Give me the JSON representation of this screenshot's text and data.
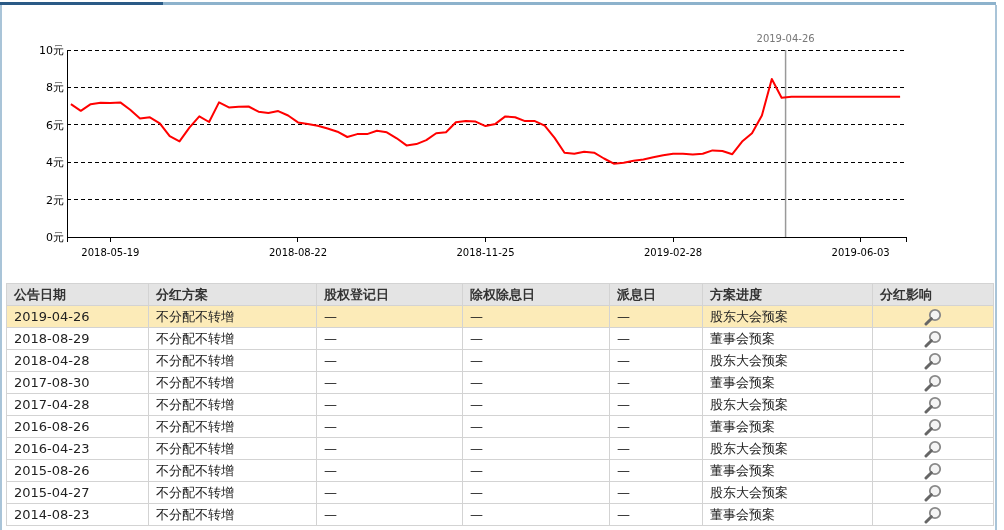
{
  "chart": {
    "chart_data": {
      "type": "line",
      "grid": true,
      "ylim": [
        0,
        10
      ],
      "yticks": [
        {
          "value": 0,
          "label": "0元"
        },
        {
          "value": 2,
          "label": "2元"
        },
        {
          "value": 4,
          "label": "4元"
        },
        {
          "value": 6,
          "label": "6元"
        },
        {
          "value": 8,
          "label": "8元"
        },
        {
          "value": 10,
          "label": "10元"
        }
      ],
      "categories": [
        null,
        null,
        null,
        null,
        "2018-05-19",
        null,
        null,
        null,
        null,
        null,
        null,
        null,
        null,
        null,
        null,
        null,
        null,
        null,
        null,
        null,
        null,
        null,
        null,
        "2018-08-22",
        null,
        null,
        null,
        null,
        null,
        null,
        null,
        null,
        null,
        null,
        null,
        null,
        null,
        null,
        null,
        null,
        null,
        null,
        "2018-11-25",
        null,
        null,
        null,
        null,
        null,
        null,
        null,
        null,
        null,
        null,
        null,
        null,
        null,
        null,
        null,
        null,
        null,
        null,
        "2019-02-28",
        null,
        null,
        null,
        null,
        null,
        null,
        null,
        null,
        null,
        null,
        null,
        null,
        null,
        null,
        null,
        null,
        null,
        null,
        "2019-06-03",
        null,
        null,
        null,
        null
      ],
      "series": [
        {
          "color": "#ff0000",
          "values": [
            7.1,
            6.75,
            7.1,
            7.18,
            7.16,
            7.2,
            6.8,
            6.34,
            6.4,
            6.08,
            5.39,
            5.11,
            5.85,
            6.45,
            6.15,
            7.2,
            6.93,
            6.97,
            6.98,
            6.7,
            6.63,
            6.73,
            6.5,
            6.13,
            6.05,
            5.95,
            5.8,
            5.63,
            5.35,
            5.5,
            5.5,
            5.68,
            5.6,
            5.28,
            4.9,
            4.97,
            5.18,
            5.55,
            5.6,
            6.14,
            6.2,
            6.17,
            5.93,
            6.05,
            6.45,
            6.4,
            6.2,
            6.2,
            5.95,
            5.3,
            4.5,
            4.45,
            4.56,
            4.51,
            4.2,
            3.92,
            3.97,
            4.08,
            4.15,
            4.27,
            4.37,
            4.45,
            4.45,
            4.41,
            4.45,
            4.63,
            4.6,
            4.43,
            5.1,
            5.55,
            6.5,
            8.45,
            7.45,
            7.5,
            7.5,
            7.5,
            7.5,
            7.5,
            7.5,
            7.5,
            7.5,
            7.5,
            7.5,
            7.5,
            7.5
          ]
        }
      ],
      "annotations": [
        "2019-04-26"
      ]
    }
  },
  "table": {
    "columns": [
      "公告日期",
      "分红方案",
      "股权登记日",
      "除权除息日",
      "派息日",
      "方案进度",
      "分红影响"
    ],
    "rows": [
      {
        "selected": true,
        "cells": [
          "2019-04-26",
          "不分配不转增",
          "—",
          "—",
          "—",
          "股东大会预案"
        ]
      },
      {
        "selected": false,
        "cells": [
          "2018-08-29",
          "不分配不转增",
          "—",
          "—",
          "—",
          "董事会预案"
        ]
      },
      {
        "selected": false,
        "cells": [
          "2018-04-28",
          "不分配不转增",
          "—",
          "—",
          "—",
          "股东大会预案"
        ]
      },
      {
        "selected": false,
        "cells": [
          "2017-08-30",
          "不分配不转增",
          "—",
          "—",
          "—",
          "董事会预案"
        ]
      },
      {
        "selected": false,
        "cells": [
          "2017-04-28",
          "不分配不转增",
          "—",
          "—",
          "—",
          "股东大会预案"
        ]
      },
      {
        "selected": false,
        "cells": [
          "2016-08-26",
          "不分配不转增",
          "—",
          "—",
          "—",
          "董事会预案"
        ]
      },
      {
        "selected": false,
        "cells": [
          "2016-04-23",
          "不分配不转增",
          "—",
          "—",
          "—",
          "股东大会预案"
        ]
      },
      {
        "selected": false,
        "cells": [
          "2015-08-26",
          "不分配不转增",
          "—",
          "—",
          "—",
          "董事会预案"
        ]
      },
      {
        "selected": false,
        "cells": [
          "2015-04-27",
          "不分配不转增",
          "—",
          "—",
          "—",
          "股东大会预案"
        ]
      },
      {
        "selected": false,
        "cells": [
          "2014-08-23",
          "不分配不转增",
          "—",
          "—",
          "—",
          "董事会预案"
        ]
      }
    ]
  }
}
